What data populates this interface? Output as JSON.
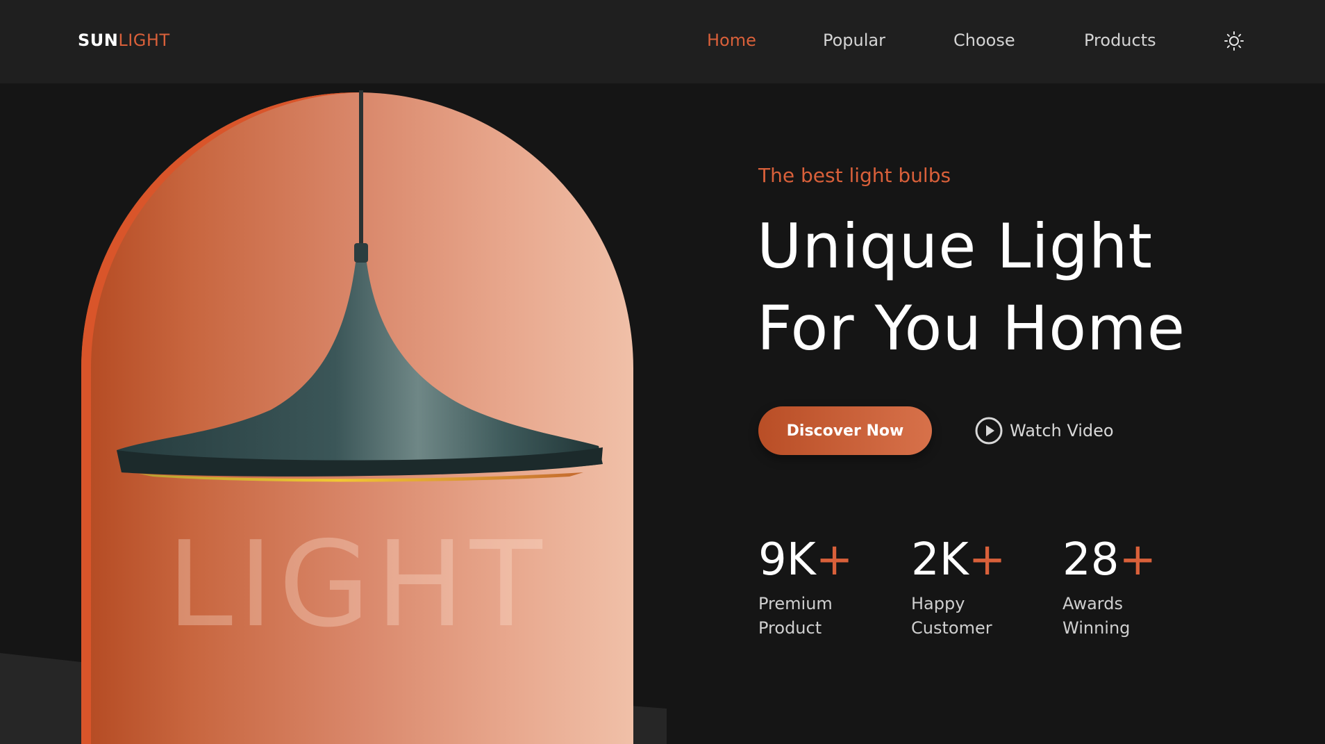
{
  "header": {
    "logo": {
      "part1": "SUN",
      "part2": "LIGHT"
    },
    "nav": [
      {
        "label": "Home",
        "active": true
      },
      {
        "label": "Popular",
        "active": false
      },
      {
        "label": "Choose",
        "active": false
      },
      {
        "label": "Products",
        "active": false
      }
    ],
    "theme_toggle_icon": "sun-icon"
  },
  "hero": {
    "eyebrow": "The best light bulbs",
    "title_line1": "Unique Light",
    "title_line2": "For You Home",
    "image_word": "LIGHT",
    "primary_button": "Discover Now",
    "secondary_button": "Watch Video",
    "secondary_button_icon": "play-circle-icon"
  },
  "stats": [
    {
      "value": "9K",
      "suffix": "+",
      "label_line1": "Premium",
      "label_line2": "Product"
    },
    {
      "value": "2K",
      "suffix": "+",
      "label_line1": "Happy",
      "label_line2": "Customer"
    },
    {
      "value": "28",
      "suffix": "+",
      "label_line1": "Awards",
      "label_line2": "Winning"
    }
  ],
  "colors": {
    "accent": "#d9603a",
    "background": "#151515",
    "header_background": "#1f1f1f",
    "text": "#ffffff"
  }
}
